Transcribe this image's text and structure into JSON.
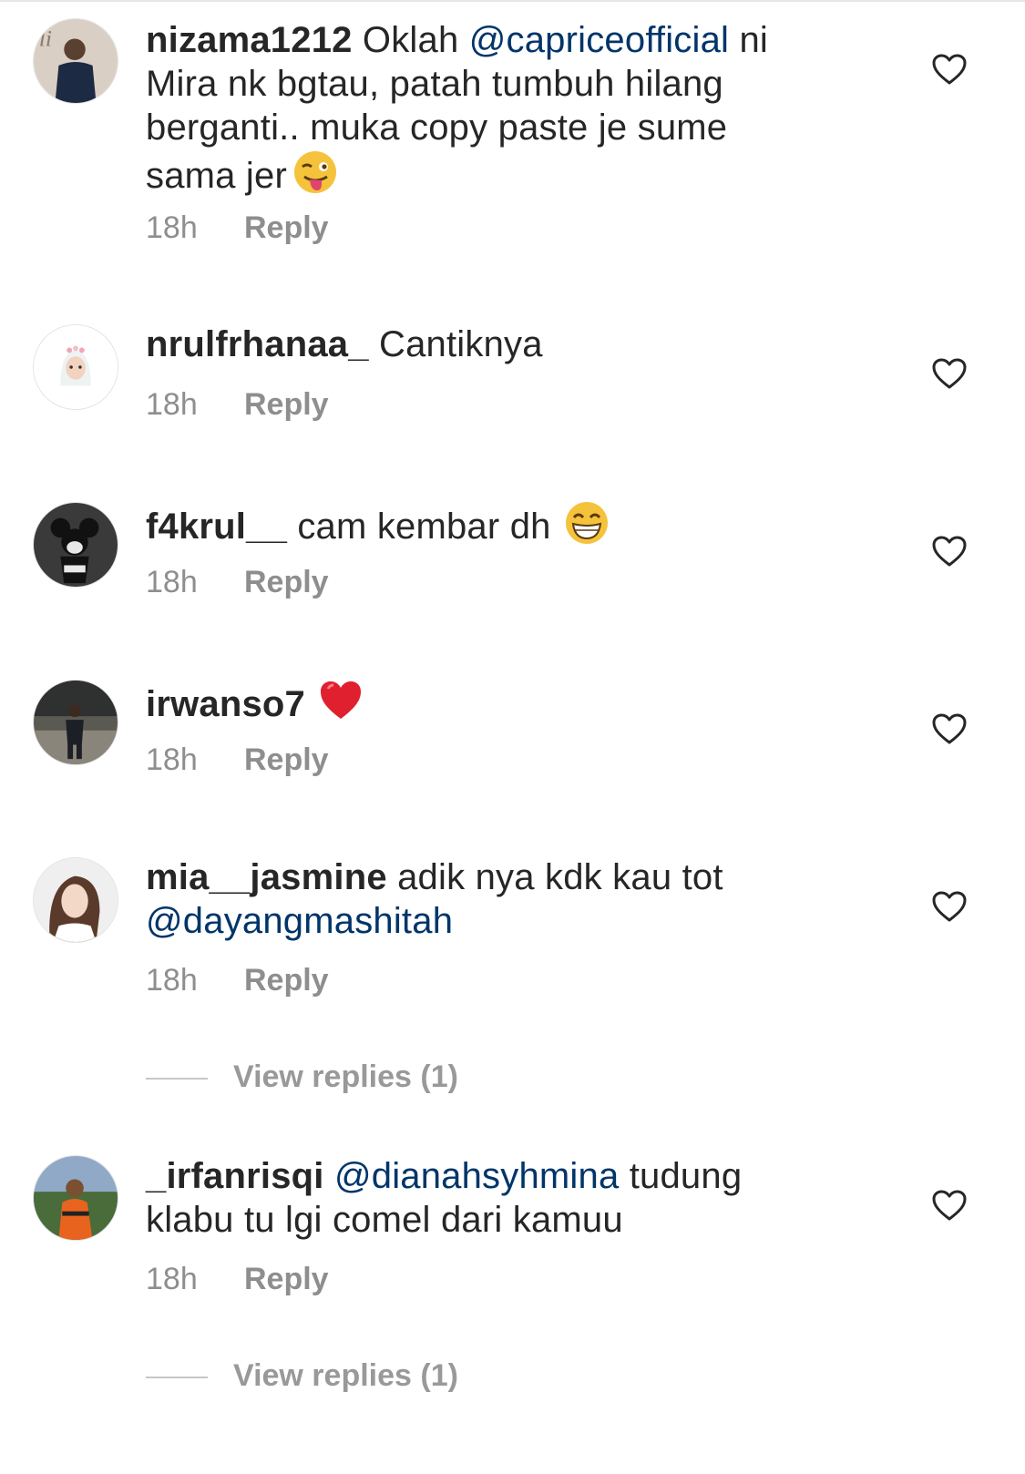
{
  "comments": [
    {
      "username": "nizama1212",
      "parts": [
        " Oklah ",
        "@capriceofficial",
        " ni Mira nk bgtau, patah tumbuh hilang berganti.. muka copy paste je sume sama jer"
      ],
      "emoji": "winking-face-with-tongue",
      "time": "18h",
      "reply_label": "Reply"
    },
    {
      "username": "nrulfrhanaa_",
      "text": " Cantiknya",
      "time": "18h",
      "reply_label": "Reply"
    },
    {
      "username": "f4krul__",
      "text": " cam kembar dh",
      "emoji": "grinning-face",
      "time": "18h",
      "reply_label": "Reply"
    },
    {
      "username": "irwanso7",
      "text": "",
      "emoji": "red-heart",
      "time": "18h",
      "reply_label": "Reply"
    },
    {
      "username": "mia__jasmine",
      "parts": [
        " adik nya kdk kau tot ",
        "@dayangmashitah"
      ],
      "time": "18h",
      "reply_label": "Reply",
      "view_replies": "View replies (1)"
    },
    {
      "username": "_irfanrisqi",
      "parts": [
        " ",
        "@dianahsyhmina",
        " tudung klabu tu lgi comel dari kamuu"
      ],
      "time": "18h",
      "reply_label": "Reply",
      "view_replies": "View replies (1)"
    }
  ],
  "colors": {
    "text": "#262626",
    "mention": "#003569",
    "meta": "#8e8e8e"
  }
}
